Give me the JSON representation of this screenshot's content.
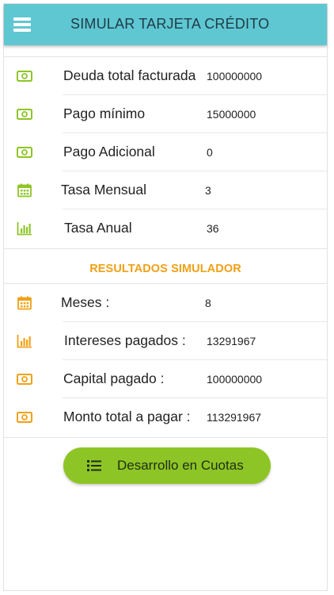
{
  "header": {
    "title": "SIMULAR TARJETA CRÉDITO",
    "menu_icon": "hamburger-menu-icon"
  },
  "colors": {
    "header_bg": "#5fc7d2",
    "input_icon": "#8ec526",
    "result_icon": "#f0a116",
    "section_title": "#f0a116",
    "button_bg": "#8ec526"
  },
  "inputs": [
    {
      "icon": "money-bill-icon",
      "label": "Deuda total facturada",
      "value": "100000000"
    },
    {
      "icon": "money-bill-icon",
      "label": "Pago mínimo",
      "value": "15000000"
    },
    {
      "icon": "money-bill-icon",
      "label": "Pago Adicional",
      "value": "0"
    },
    {
      "icon": "calendar-icon",
      "label": "Tasa Mensual",
      "value": "3"
    },
    {
      "icon": "bar-chart-icon",
      "label": "Tasa Anual",
      "value": "36"
    }
  ],
  "results_title": "RESULTADOS SIMULADOR",
  "results": [
    {
      "icon": "calendar-icon",
      "label": "Meses :",
      "value": "8"
    },
    {
      "icon": "bar-chart-icon",
      "label": "Intereses pagados :",
      "value": "13291967"
    },
    {
      "icon": "money-bill-icon",
      "label": "Capital pagado :",
      "value": "100000000"
    },
    {
      "icon": "money-bill-icon",
      "label": "Monto total a pagar :",
      "value": "113291967"
    }
  ],
  "cta": {
    "icon": "list-icon",
    "label": "Desarrollo en Cuotas"
  }
}
